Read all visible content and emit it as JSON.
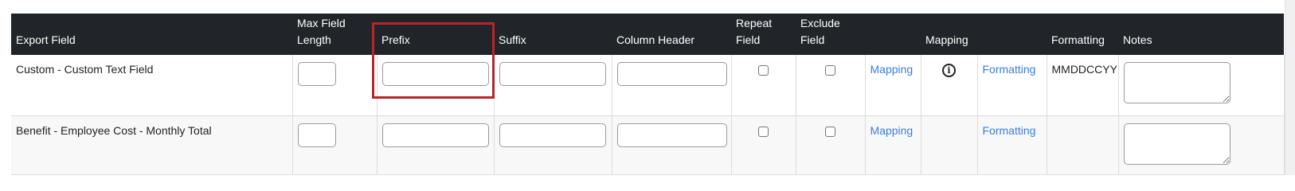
{
  "header": {
    "export_field": "Export Field",
    "max_field_length": "Max Field Length",
    "prefix": "Prefix",
    "suffix": "Suffix",
    "column_header": "Column Header",
    "repeat_field": "Repeat Field",
    "exclude_field": "Exclude Field",
    "mapping": "Mapping",
    "formatting": "Formatting",
    "notes": "Notes"
  },
  "rows": [
    {
      "export_field": "Custom - Custom Text Field",
      "max_field_length": "",
      "prefix": "",
      "suffix": "",
      "column_header": "",
      "repeat_field": false,
      "exclude_field": false,
      "mapping_link": "Mapping",
      "mapping_info_icon": "info-icon",
      "formatting_link": "Formatting",
      "formatting_value": "MMDDCCYY",
      "notes": ""
    },
    {
      "export_field": "Benefit - Employee Cost - Monthly Total",
      "max_field_length": "",
      "prefix": "",
      "suffix": "",
      "column_header": "",
      "repeat_field": false,
      "exclude_field": false,
      "mapping_link": "Mapping",
      "formatting_link": "Formatting",
      "formatting_value": "",
      "notes": ""
    }
  ],
  "colors": {
    "header_bg": "#212529",
    "link": "#3b7ddd",
    "highlight": "#b3262c"
  }
}
